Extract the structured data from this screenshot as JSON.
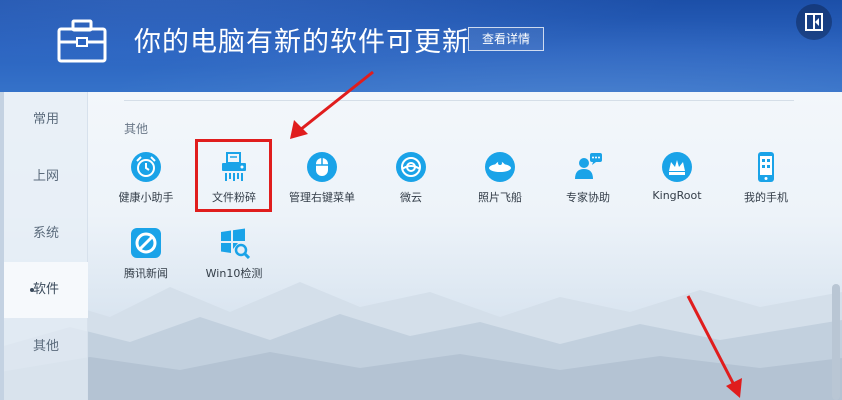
{
  "header": {
    "title": "你的电脑有新的软件可更新",
    "detail_button": "查看详情"
  },
  "sidebar": {
    "items": [
      {
        "label": "常用",
        "active": false
      },
      {
        "label": "上网",
        "active": false
      },
      {
        "label": "系统",
        "active": false
      },
      {
        "label": "软件",
        "active": true
      },
      {
        "label": "其他",
        "active": false
      }
    ]
  },
  "section": {
    "title": "其他",
    "tools": [
      {
        "label": "健康小助手",
        "icon": "alarm-clock-icon",
        "color": "#1aa3e8"
      },
      {
        "label": "文件粉碎",
        "icon": "file-shredder-icon",
        "color": "#1aa3e8",
        "highlighted": true
      },
      {
        "label": "管理右键菜单",
        "icon": "mouse-icon",
        "color": "#1aa3e8"
      },
      {
        "label": "微云",
        "icon": "cloud-icon",
        "color": "#1aa3e8"
      },
      {
        "label": "照片飞船",
        "icon": "spaceship-icon",
        "color": "#1aa3e8"
      },
      {
        "label": "专家协助",
        "icon": "expert-chat-icon",
        "color": "#1aa3e8"
      },
      {
        "label": "KingRoot",
        "icon": "crown-icon",
        "color": "#1aa3e8"
      },
      {
        "label": "我的手机",
        "icon": "phone-icon",
        "color": "#1aa3e8"
      },
      {
        "label": "腾讯新闻",
        "icon": "tencent-news-icon",
        "color": "#1aa3e8"
      },
      {
        "label": "Win10检测",
        "icon": "win10-check-icon",
        "color": "#1aa3e8"
      }
    ]
  },
  "annotations": {
    "color": "#e01d1d"
  }
}
